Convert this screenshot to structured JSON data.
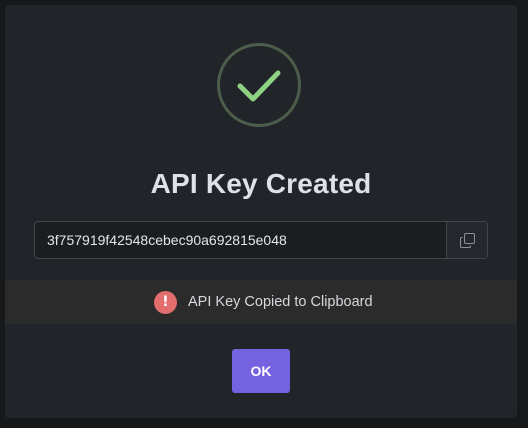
{
  "dialog": {
    "title": "API Key Created",
    "success_icon": "check-circle-icon",
    "api_key_value": "3f757919f42548cebec90a692815e048",
    "copy_icon": "copy-icon",
    "notice": {
      "icon": "alert-circle-icon",
      "text": "API Key Copied to Clipboard"
    },
    "ok_label": "OK"
  },
  "colors": {
    "accent": "#7562e0",
    "success": "#8fd282",
    "alert": "#e26d6d",
    "modal_bg": "#212429"
  }
}
